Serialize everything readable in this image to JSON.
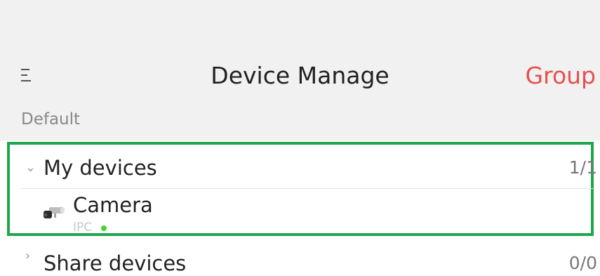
{
  "header": {
    "title": "Device Manage",
    "group_label": "Group",
    "menu_icon": "menu-icon",
    "background": "#f1f1f1"
  },
  "default_label": "Default",
  "groups": [
    {
      "name": "My devices",
      "count": "1/1",
      "expanded": true,
      "chevron": "chevron-down-icon",
      "devices": [
        {
          "name": "Camera",
          "type": "IPC",
          "icon": "camera-icon",
          "status": "online",
          "status_color": "#4cd137"
        }
      ]
    },
    {
      "name": "Share devices",
      "count": "0/0",
      "expanded": false,
      "chevron": "chevron-right-icon"
    }
  ],
  "colors": {
    "accent": "#e94f4f",
    "highlight": "#1ea64c"
  }
}
